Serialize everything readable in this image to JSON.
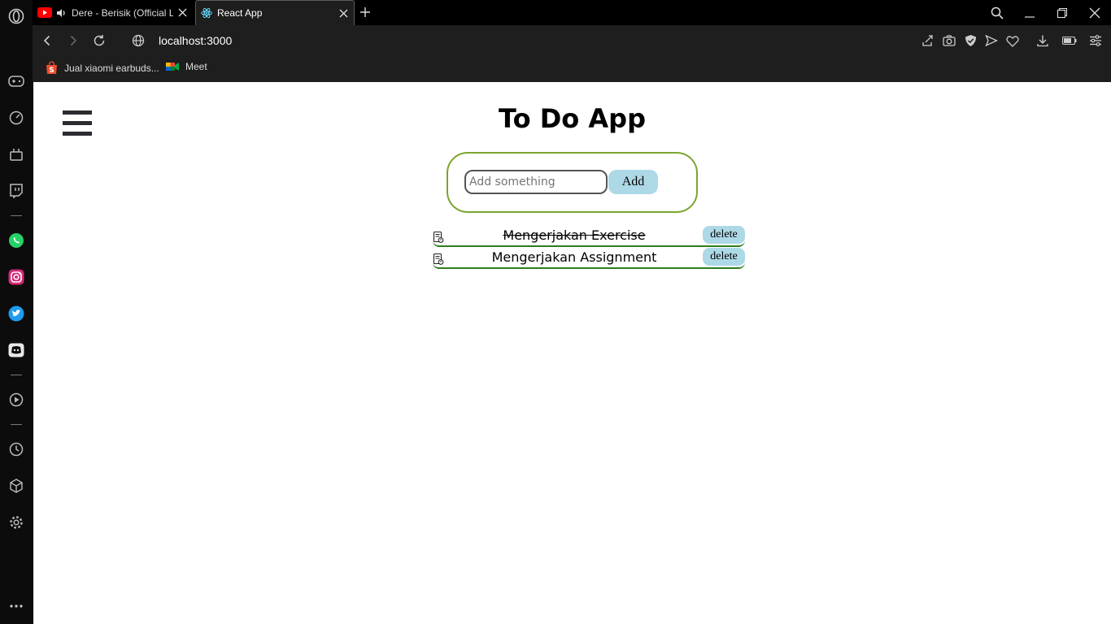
{
  "browser": {
    "tabs": [
      {
        "title": "Dere - Berisik (Official L",
        "icon": "youtube-icon",
        "audio": true,
        "active": false
      },
      {
        "title": "React App",
        "icon": "react-icon",
        "active": true
      }
    ],
    "url": "localhost:3000",
    "bookmarks": [
      {
        "label": "Jual xiaomi earbuds...",
        "icon": "shopee-icon"
      },
      {
        "label": "Meet",
        "icon": "google-meet-icon"
      }
    ],
    "sidebar_icons": [
      "gamepad-icon",
      "speed-dial-icon",
      "flow-icon",
      "twitch-icon",
      "whatsapp-icon",
      "instagram-icon",
      "twitter-icon",
      "discord-icon",
      "player-icon",
      "history-icon",
      "extensions-icon",
      "settings-icon",
      "more-icon"
    ]
  },
  "app": {
    "title": "To Do App",
    "input_placeholder": "Add something",
    "add_label": "Add",
    "todos": [
      {
        "text": "Mengerjakan Exercise",
        "completed": true,
        "delete_label": "delete"
      },
      {
        "text": "Mengerjakan Assignment",
        "completed": false,
        "delete_label": "delete"
      }
    ]
  },
  "colors": {
    "form_border": "#7ca42e",
    "button_bg": "#add8e6",
    "item_border": "#2e7d1e"
  }
}
